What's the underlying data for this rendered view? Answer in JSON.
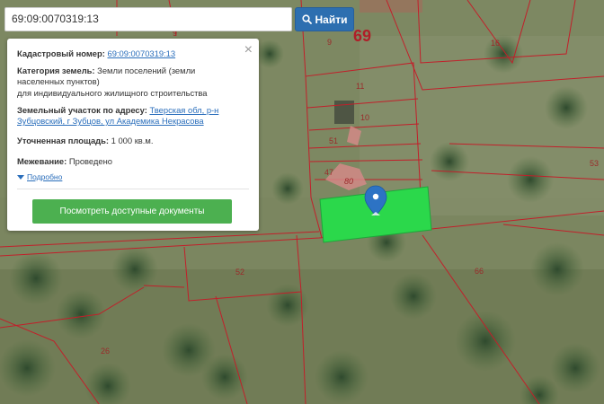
{
  "search": {
    "value": "69:09:0070319:13",
    "button_label": "Найти"
  },
  "card": {
    "cadastral_label": "Кадастровый номер:",
    "cadastral_value": "69:09:0070319:13",
    "category_label": "Категория земель:",
    "category_value_1": "Земли поселений (земли",
    "category_value_2": "населенных пунктов)",
    "category_value_3": "для индивидуального жилищного строительства",
    "address_label": "Земельный участок по адресу:",
    "address_value_1": "Тверская обл, р-н",
    "address_value_2": "Зубцовский, г Зубцов, ул Академика Некрасова",
    "area_label": "Уточненная площадь:",
    "area_value": "1 000 кв.м.",
    "survey_label": "Межевание:",
    "survey_value": "Проведено",
    "more_label": "Подробно",
    "docs_button": "Посмотреть доступные документы"
  },
  "map": {
    "region_label": "69",
    "plot_labels": [
      "9",
      "16",
      "11",
      "10",
      "51",
      "47",
      "80",
      "53",
      "52",
      "66",
      "26",
      "9"
    ],
    "highlight_color": "#2bd84b",
    "boundary_color": "#c21f2a"
  }
}
